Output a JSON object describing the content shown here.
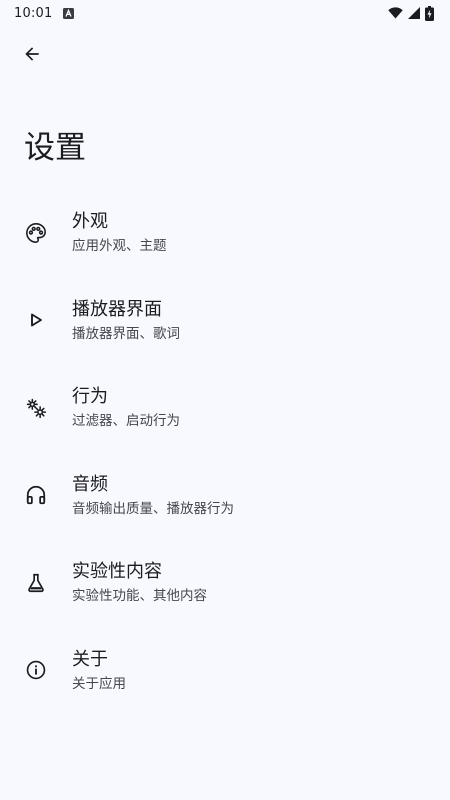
{
  "status_bar": {
    "time": "10:01",
    "notification_icon": "a-letter-icon",
    "icons": [
      "wifi-icon",
      "signal-icon",
      "battery-charging-icon"
    ]
  },
  "header": {
    "back_icon": "arrow-back-icon",
    "title": "设置"
  },
  "settings": {
    "items": [
      {
        "icon": "palette-icon",
        "title": "外观",
        "subtitle": "应用外观、主题"
      },
      {
        "icon": "play-outline-icon",
        "title": "播放器界面",
        "subtitle": "播放器界面、歌词"
      },
      {
        "icon": "gears-icon",
        "title": "行为",
        "subtitle": "过滤器、启动行为"
      },
      {
        "icon": "headphones-icon",
        "title": "音频",
        "subtitle": "音频输出质量、播放器行为"
      },
      {
        "icon": "flask-icon",
        "title": "实验性内容",
        "subtitle": "实验性功能、其他内容"
      },
      {
        "icon": "info-icon",
        "title": "关于",
        "subtitle": "关于应用"
      }
    ]
  },
  "colors": {
    "background": "#f8f9fe",
    "text_primary": "#1b1c20",
    "text_secondary": "#45464f"
  }
}
